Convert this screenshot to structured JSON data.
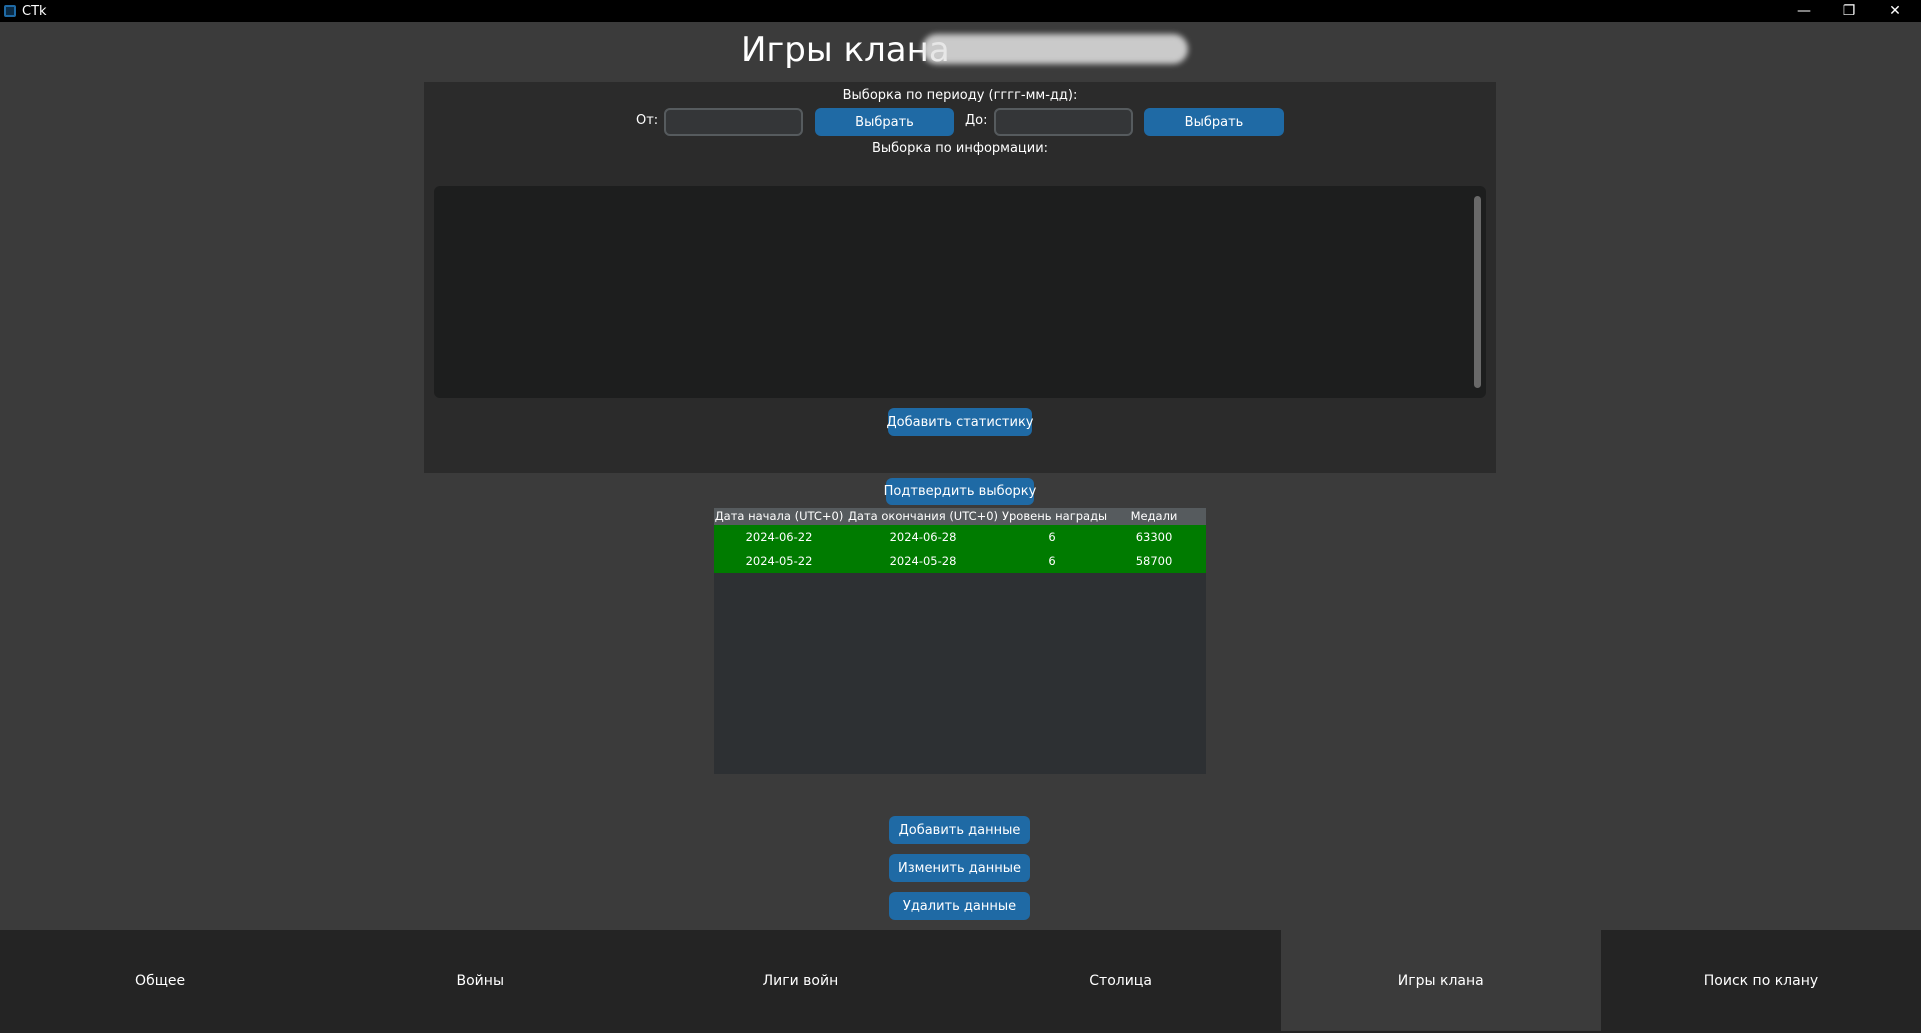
{
  "window": {
    "title": "CTk",
    "minimize_glyph": "—",
    "maximize_glyph": "❐",
    "close_glyph": "✕"
  },
  "page": {
    "title": "Игры клана"
  },
  "period_filter": {
    "heading": "Выборка по периоду (гггг-мм-дд):",
    "from_label": "От:",
    "from_value": "",
    "from_button": "Выбрать",
    "to_label": "До:",
    "to_value": "",
    "to_button": "Выбрать"
  },
  "info_filter": {
    "heading": "Выборка по информации:",
    "add_stat_button": "Добавить статистику"
  },
  "confirm_button": "Подтвердить выборку",
  "table": {
    "columns": [
      "Дата начала (UTC+0)",
      "Дата окончания (UTC+0)",
      "Уровень награды",
      "Медали"
    ],
    "rows": [
      [
        "2024-06-22",
        "2024-06-28",
        "6",
        "63300"
      ],
      [
        "2024-05-22",
        "2024-05-28",
        "6",
        "58700"
      ]
    ],
    "row_color": "#007b00"
  },
  "actions": {
    "add": "Добавить данные",
    "edit": "Изменить данные",
    "delete": "Удалить данные"
  },
  "tabs": [
    {
      "label": "Общее"
    },
    {
      "label": "Войны"
    },
    {
      "label": "Лиги войн"
    },
    {
      "label": "Столица"
    },
    {
      "label": "Игры клана",
      "active": true
    },
    {
      "label": "Поиск по клану"
    }
  ],
  "colors": {
    "accent": "#1f6aa5",
    "background": "#3b3b3b",
    "panel": "#2b2b2b"
  }
}
